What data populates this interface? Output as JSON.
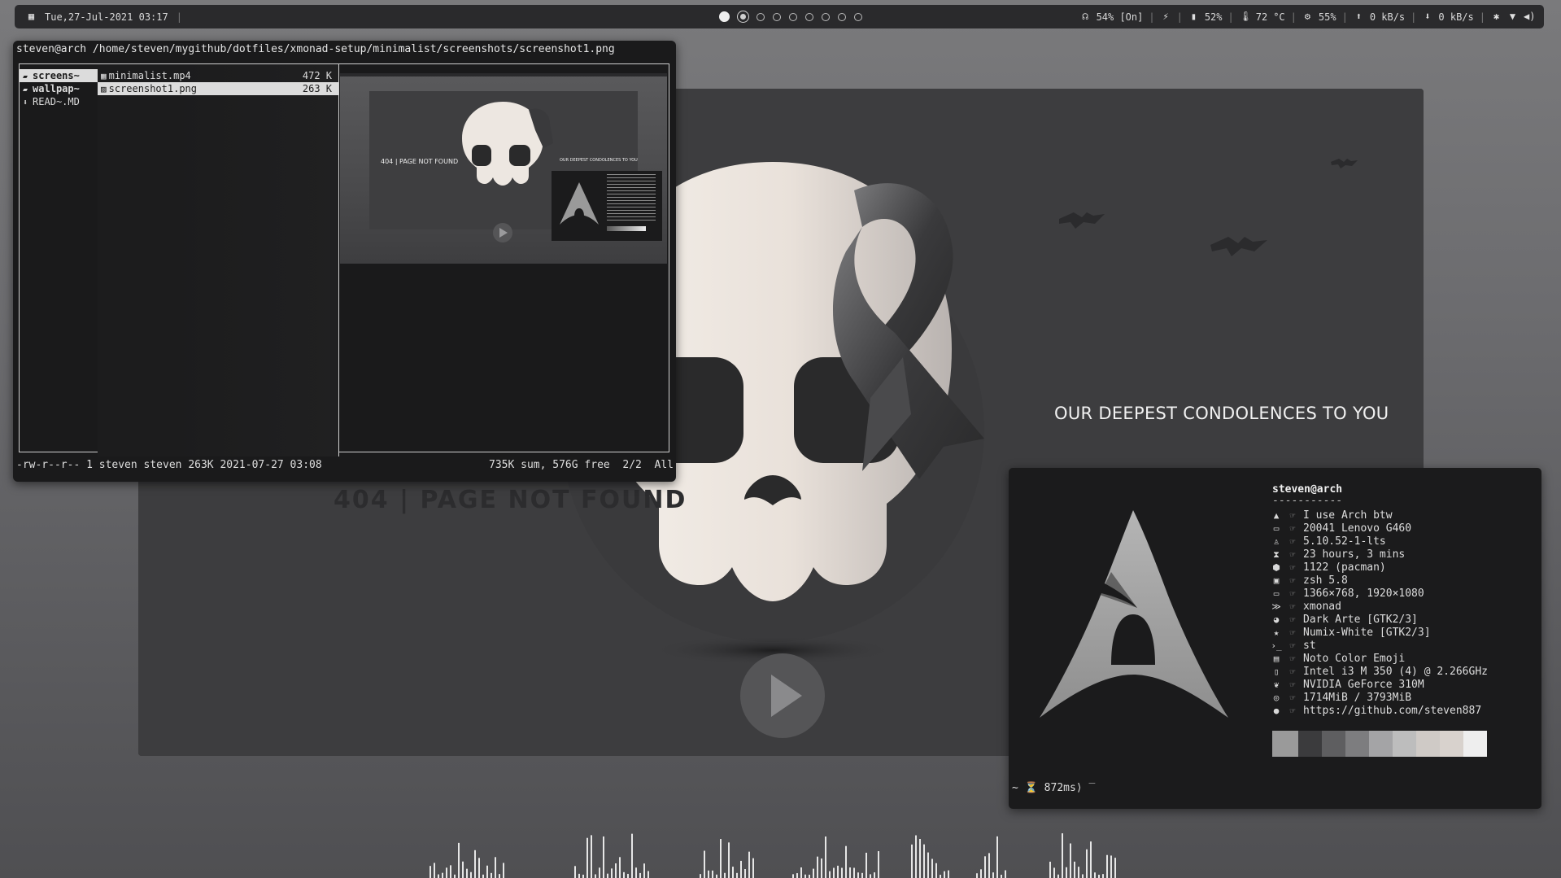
{
  "topbar": {
    "datetime": "Tue,27-Jul-2021 03:17",
    "divider": "|",
    "workspaces": [
      "current",
      "visible",
      "empty",
      "empty",
      "empty",
      "empty",
      "empty",
      "empty",
      "empty"
    ],
    "volume": "54% [On]",
    "battery": "52%",
    "temperature": "72",
    "temp_unit": "°C",
    "cpu": "55%",
    "upload": "0 kB/s",
    "download": "0 kB/s",
    "icons": [
      "calendar-icon",
      "headphones-icon",
      "plug-icon",
      "battery-icon",
      "thermometer-icon",
      "cpu-icon",
      "upload-icon",
      "download-icon",
      "bluetooth-icon",
      "wifi-icon",
      "speaker-icon"
    ]
  },
  "wallpaper": {
    "title": "OUR DEEPEST CONDOLENCES TO YOU",
    "subtitle": "404 | PAGE NOT FOUND"
  },
  "ranger": {
    "path": "steven@arch /home/steven/mygithub/dotfiles/xmonad-setup/minimalist/screenshots/screenshot1.png",
    "parent_items": [
      {
        "name": "screens~",
        "type": "dir",
        "selected": true
      },
      {
        "name": "wallpap~",
        "type": "dir",
        "selected": false
      },
      {
        "name": "READ~.MD",
        "type": "file",
        "selected": false
      }
    ],
    "files": [
      {
        "name": "minimalist.mp4",
        "size": "472 K",
        "selected": false
      },
      {
        "name": "screenshot1.png",
        "size": "263 K",
        "selected": true
      }
    ],
    "preview": {
      "title": "OUR DEEPEST CONDOLENCES TO YOU",
      "subtitle": "404 | PAGE NOT FOUND"
    },
    "status_left": "-rw-r--r-- 1 steven steven 263K 2021-07-27 03:08",
    "status_right": "735K sum, 576G free  2/2  All"
  },
  "neofetch": {
    "user": "steven@arch",
    "dashes": "-----------",
    "lines": [
      {
        "icon": "arch-icon",
        "glyph": "▲",
        "value": "I use Arch btw"
      },
      {
        "icon": "laptop-icon",
        "glyph": "▭",
        "value": "20041 Lenovo G460"
      },
      {
        "icon": "tux-icon",
        "glyph": "♙",
        "value": "5.10.52-1-lts"
      },
      {
        "icon": "hourglass-icon",
        "glyph": "⧗",
        "value": "23 hours, 3 mins"
      },
      {
        "icon": "package-icon",
        "glyph": "⬢",
        "value": "1122 (pacman)"
      },
      {
        "icon": "shell-icon",
        "glyph": "▣",
        "value": "zsh 5.8"
      },
      {
        "icon": "monitor-icon",
        "glyph": "▭",
        "value": "1366×768, 1920×1080"
      },
      {
        "icon": "wm-icon",
        "glyph": "≫",
        "value": "xmonad"
      },
      {
        "icon": "palette-icon",
        "glyph": "◕",
        "value": "Dark Arte [GTK2/3]"
      },
      {
        "icon": "star-icon",
        "glyph": "★",
        "value": "Numix-White [GTK2/3]"
      },
      {
        "icon": "terminal-icon",
        "glyph": "›_",
        "value": "st"
      },
      {
        "icon": "font-icon",
        "glyph": "▤",
        "value": "Noto Color Emoji"
      },
      {
        "icon": "cpu-icon",
        "glyph": "▯",
        "value": "Intel i3 M 350 (4) @ 2.266GHz"
      },
      {
        "icon": "gpu-icon",
        "glyph": "❦",
        "value": "NVIDIA GeForce 310M"
      },
      {
        "icon": "memory-icon",
        "glyph": "◎",
        "value": "1714MiB / 3793MiB"
      },
      {
        "icon": "github-icon",
        "glyph": "●",
        "value": "https://github.com/steven887"
      }
    ],
    "palette": [
      "#9a9a9a",
      "#3b3b3d",
      "#5e5e60",
      "#7d7d7f",
      "#a4a4a6",
      "#bdbdbd",
      "#cfcac6",
      "#d8d2cd",
      "#eeeeee"
    ],
    "prompt": "~ ⏳ 872ms⟩ ‾"
  },
  "colors": {
    "bar": "#2a2a2c",
    "terminal": "#1b1b1c",
    "accent": "#dcdcdc"
  }
}
